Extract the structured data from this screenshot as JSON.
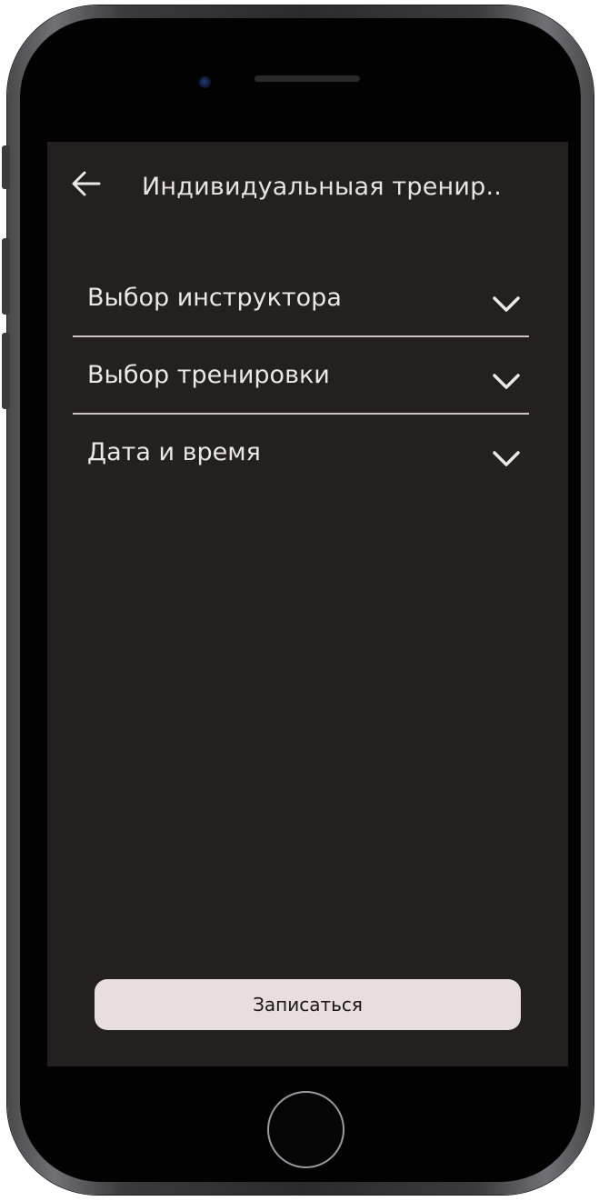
{
  "header": {
    "title": "Индивидуальныая тренир..",
    "back_icon": "arrow-left-icon"
  },
  "menu": {
    "items": [
      {
        "label": "Выбор инструктора",
        "icon": "chevron-down-icon"
      },
      {
        "label": "Выбор тренировки",
        "icon": "chevron-down-icon"
      },
      {
        "label": "Дата и время",
        "icon": "chevron-down-icon"
      }
    ]
  },
  "actions": {
    "signup_label": "Записаться"
  },
  "colors": {
    "screen_background": "#252020",
    "text_primary": "#ece7e7",
    "button_background": "#e8dede",
    "button_text": "#1a1616",
    "divider": "#cbc5c5"
  }
}
